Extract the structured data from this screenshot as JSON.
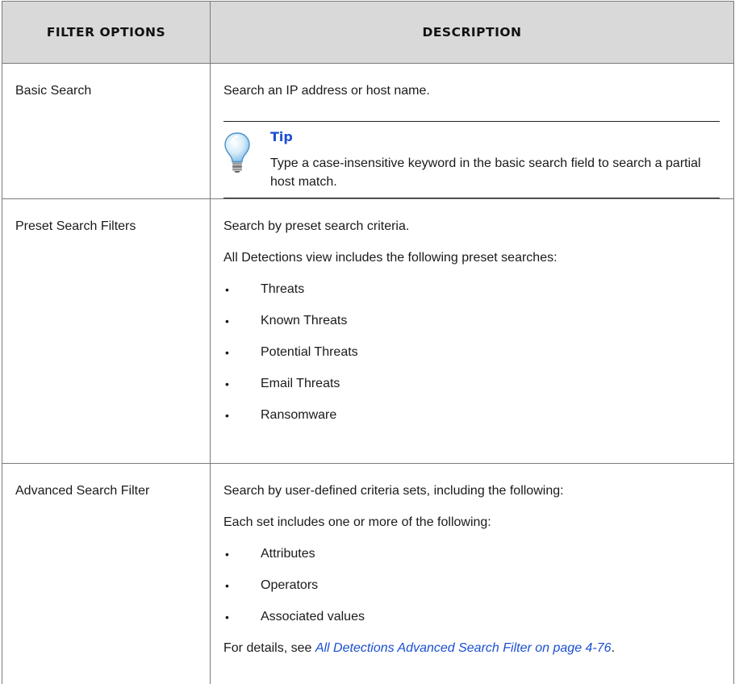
{
  "table": {
    "headers": {
      "col1": "Filter Options",
      "col2": "Description"
    },
    "rows": {
      "basic": {
        "option": "Basic Search",
        "description": "Search an IP address or host name.",
        "tip": {
          "title": "Tip",
          "text": "Type a case-insensitive keyword in the basic search field to search a partial host match."
        }
      },
      "preset": {
        "option": "Preset Search Filters",
        "intro": "Search by preset search criteria.",
        "lead": "All Detections view includes the following preset searches:",
        "items": [
          "Threats",
          "Known Threats",
          "Potential Threats",
          "Email Threats",
          "Ransomware"
        ]
      },
      "advanced": {
        "option": "Advanced Search Filter",
        "intro": "Search by user-defined criteria sets, including the following:",
        "lead": "Each set includes one or more of the following:",
        "items": [
          "Attributes",
          "Operators",
          "Associated values"
        ],
        "details_prefix": "For details, see ",
        "details_link": "All Detections Advanced Search Filter on page 4-76",
        "details_suffix": "."
      }
    }
  },
  "icons": {
    "tip": "lightbulb-icon",
    "bullet": "•"
  },
  "colors": {
    "header_bg": "#d9d9d9",
    "link": "#1a4fd1",
    "border": "#7a7a7a"
  }
}
